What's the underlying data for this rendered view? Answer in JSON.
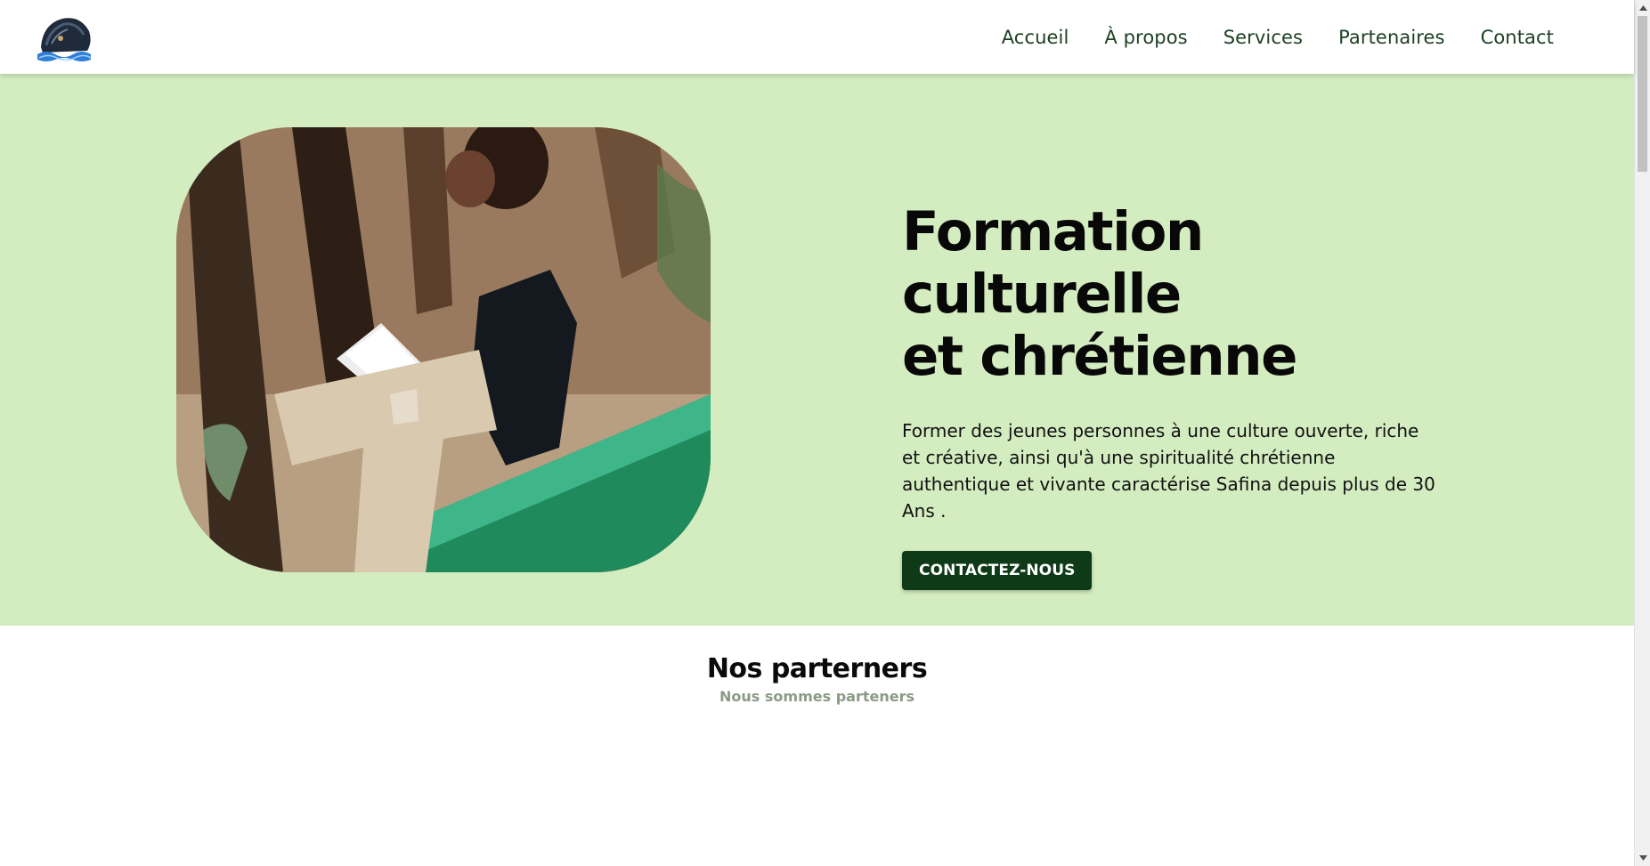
{
  "header": {
    "logo_icon": "safina-ship-logo-icon",
    "nav": [
      {
        "label": "Accueil"
      },
      {
        "label": "À propos"
      },
      {
        "label": "Services"
      },
      {
        "label": "Partenaires"
      },
      {
        "label": "Contact"
      }
    ]
  },
  "hero": {
    "title_line1": "Formation culturelle",
    "title_line2": "et chrétienne",
    "description": "Former des jeunes personnes à une culture ouverte, riche et créative, ainsi qu'à une spiritualité chrétienne authentique et vivante caractérise Safina depuis plus de 30 Ans .",
    "cta_label": "CONTACTEZ-NOUS",
    "background_color": "#d3edc0",
    "cta_color": "#0f3a17"
  },
  "partners": {
    "title": "Nos parterners",
    "subtitle": "Nous sommes parteners"
  },
  "colors": {
    "nav_text": "#1d4023",
    "subtitle": "#8a9a84"
  }
}
